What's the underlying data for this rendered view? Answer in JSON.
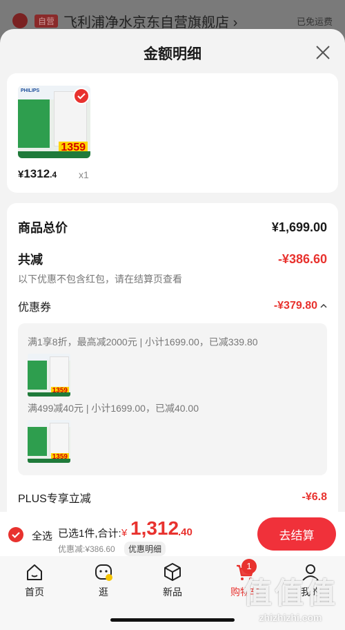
{
  "background": {
    "tag": "自营",
    "store_name": "飞利浦净水京东自营旗舰店 ›",
    "shipping": "已免运费"
  },
  "sheet": {
    "title": "金额明细"
  },
  "product": {
    "thumb_brand": "PHILIPS",
    "thumb_price": "1359",
    "unit_price_currency": "¥",
    "unit_price_int": "1312",
    "unit_price_dec": ".4",
    "quantity": "x1"
  },
  "detail": {
    "total_label": "商品总价",
    "total_value": "¥1,699.00",
    "minus_label": "共减",
    "minus_value": "-¥386.60",
    "note": "以下优惠不包含红包，请在结算页查看",
    "coupon_label": "优惠券",
    "coupon_value": "-¥379.80",
    "coupon_lines": [
      "满1享8折，最高减2000元 | 小计1699.00，已减339.80",
      "满499减40元 | 小计1699.00，已减40.00"
    ],
    "plus_label": "PLUS专享立减",
    "plus_value": "-¥6.8"
  },
  "checkout": {
    "select_all": "全选",
    "selected": "已选1件,合计:",
    "total_currency": "¥",
    "total_int": "1,312",
    "total_dec": ".40",
    "saved": "优惠减:¥386.60",
    "detail_link": "优惠明细",
    "button": "去结算"
  },
  "tabbar": {
    "items": [
      {
        "label": "首页",
        "icon": "home-icon"
      },
      {
        "label": "逛",
        "icon": "browse-icon"
      },
      {
        "label": "新品",
        "icon": "cube-icon"
      },
      {
        "label": "购物车",
        "icon": "cart-icon"
      },
      {
        "label": "我的",
        "icon": "user-icon"
      }
    ],
    "cart_badge": "1"
  },
  "watermark": {
    "logo": "值值值",
    "url": "zhizhizhi.com"
  },
  "colors": {
    "accent_red": "#e8322e",
    "button_red": "#f0313a"
  }
}
